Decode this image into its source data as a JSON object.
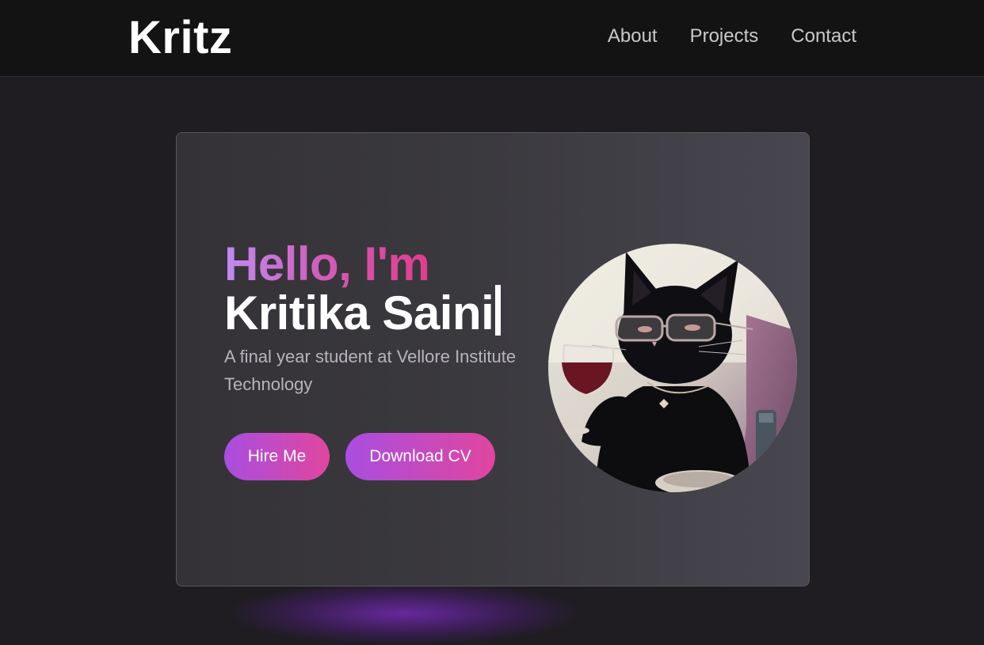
{
  "nav": {
    "logo": "Kritz",
    "links": [
      "About",
      "Projects",
      "Contact"
    ]
  },
  "hero": {
    "greeting": "Hello, I'm",
    "name": "Kritika Saini",
    "tagline": "A final year student at Vellore Institute Technology",
    "hire_label": "Hire Me",
    "cv_label": "Download CV",
    "avatar_description_icon": "cat-with-glasses-and-wine-icon"
  },
  "colors": {
    "background": "#1f1d21",
    "nav_background": "#131313",
    "accent_purple": "#a94ee0",
    "accent_pink": "#e0469e"
  }
}
